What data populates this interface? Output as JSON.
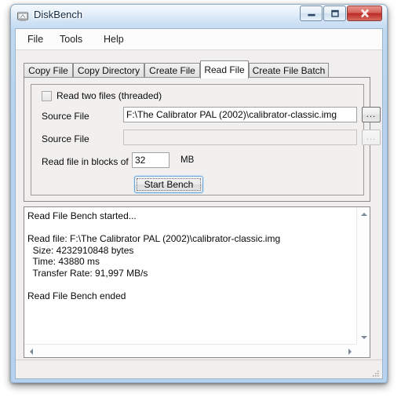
{
  "window": {
    "title": "DiskBench",
    "icon": "disk-monitor-icon",
    "controls": {
      "minimize": "minimize-icon",
      "maximize": "maximize-icon",
      "close": "close-icon"
    }
  },
  "menu": {
    "items": [
      {
        "label": "File"
      },
      {
        "label": "Tools"
      },
      {
        "label": "Help"
      }
    ]
  },
  "tabs": {
    "selected": "Read File",
    "items": [
      {
        "label": "Copy File"
      },
      {
        "label": "Copy Directory"
      },
      {
        "label": "Create File"
      },
      {
        "label": "Read File"
      },
      {
        "label": "Create File Batch"
      }
    ]
  },
  "form": {
    "threaded_checkbox": {
      "label": "Read two files (threaded)",
      "checked": false
    },
    "source_file_1": {
      "label": "Source File",
      "value": "F:\\The Calibrator PAL (2002)\\calibrator-classic.img",
      "placeholder": "",
      "browse_label": "...",
      "enabled": true
    },
    "source_file_2": {
      "label": "Source File",
      "value": "",
      "placeholder": "",
      "browse_label": "...",
      "enabled": false
    },
    "block_size": {
      "label": "Read file in blocks of",
      "value": "32",
      "unit": "MB"
    },
    "start_button": {
      "label": "Start Bench"
    }
  },
  "output": {
    "text": "Read File Bench started...\n\nRead file: F:\\The Calibrator PAL (2002)\\calibrator-classic.img\n  Size: 4232910848 bytes\n  Time: 43880 ms\n  Transfer Rate: 91,997 MB/s\n\nRead File Bench ended",
    "lines": [
      "Read File Bench started...",
      "",
      "Read file: F:\\The Calibrator PAL (2002)\\calibrator-classic.img",
      "  Size: 4232910848 bytes",
      "  Time: 43880 ms",
      "  Transfer Rate: 91,997 MB/s",
      "",
      "Read File Bench ended"
    ],
    "results": {
      "file": "F:\\The Calibrator PAL (2002)\\calibrator-classic.img",
      "size_bytes": "4232910848",
      "time_ms": "43880",
      "transfer_rate": "91,997 MB/s"
    }
  },
  "status_bar": {
    "text": ""
  },
  "colors": {
    "frame": "#b6d2ee",
    "client": "#f0eeee",
    "close_button": "#bc2b24",
    "focus_ring": "#6fa8d8"
  }
}
